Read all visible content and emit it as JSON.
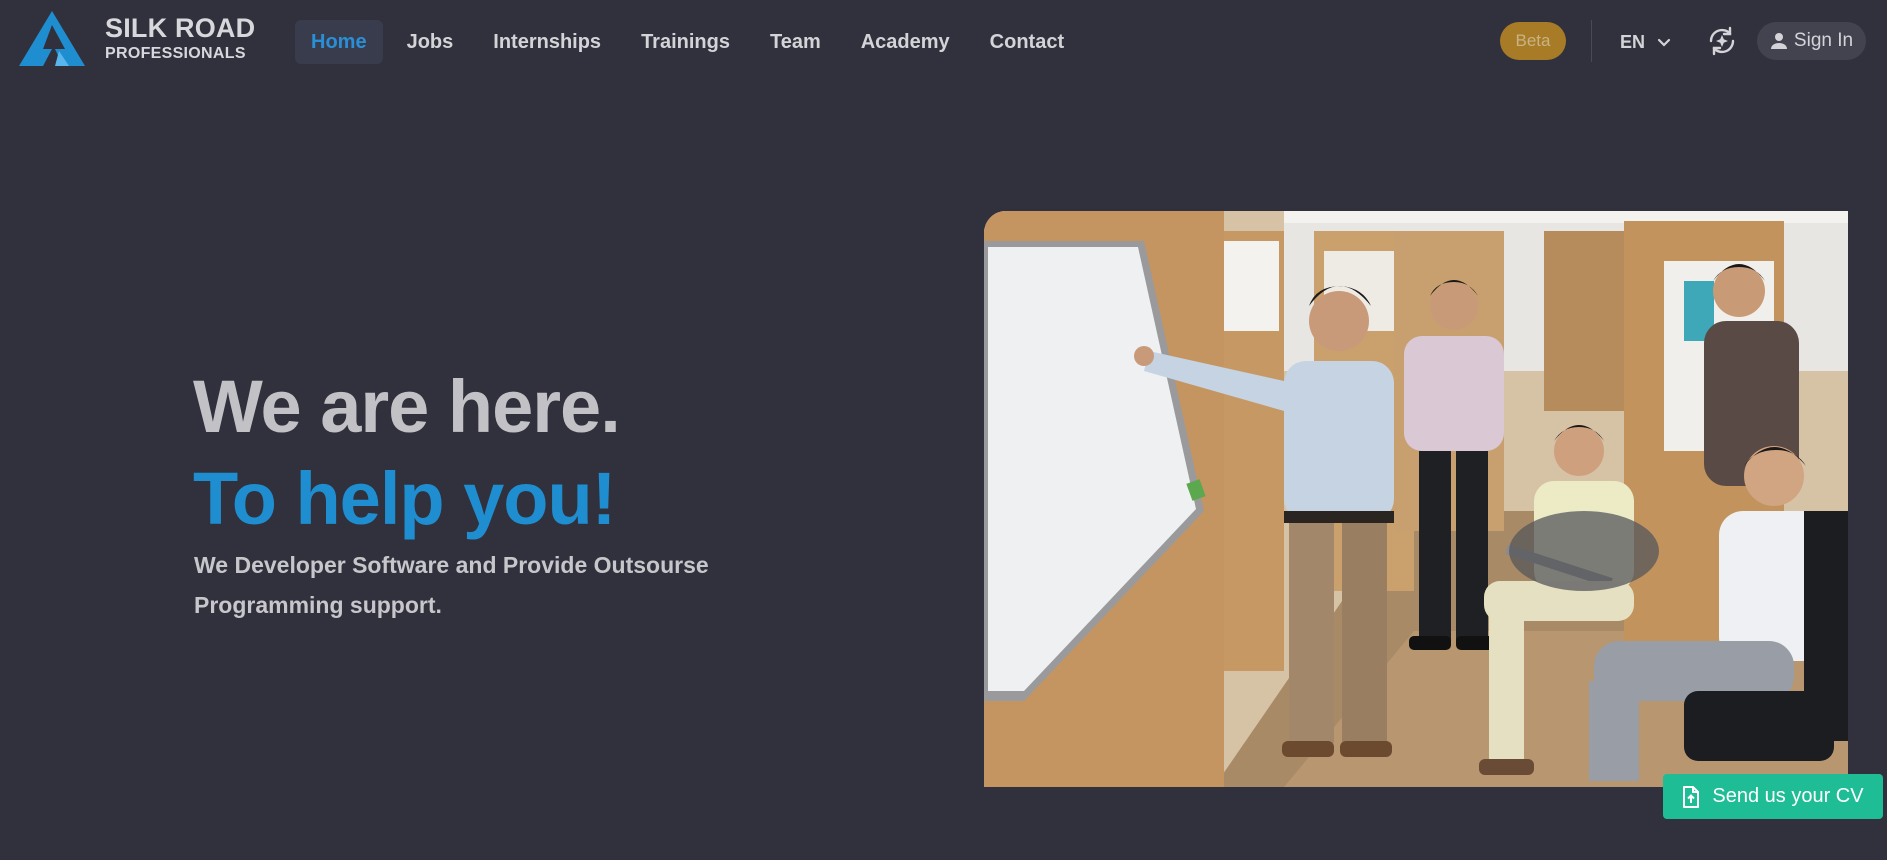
{
  "brand": {
    "name_line1": "SILK ROAD",
    "name_line2": "PROFESSIONALS",
    "logo_icon": "mountain-logo-icon",
    "accent_color": "#1f8ed0"
  },
  "nav": {
    "items": [
      {
        "label": "Home",
        "active": true
      },
      {
        "label": "Jobs",
        "active": false
      },
      {
        "label": "Internships",
        "active": false
      },
      {
        "label": "Trainings",
        "active": false
      },
      {
        "label": "Team",
        "active": false
      },
      {
        "label": "Academy",
        "active": false
      },
      {
        "label": "Contact",
        "active": false
      }
    ]
  },
  "header_actions": {
    "beta_label": "Beta",
    "beta_color": "#a87b27",
    "language": "EN",
    "language_icon": "chevron-down-icon",
    "sync_icon": "sync-icon",
    "signin_label": "Sign In",
    "signin_icon": "user-icon"
  },
  "hero": {
    "title_line1": "We are here.",
    "title_line2": "To help you!",
    "subtitle": "We Developer Software and Provide Outsourse Programming support."
  },
  "cv_button": {
    "label": "Send us your CV",
    "icon": "file-upload-icon",
    "color": "#1fbd96"
  }
}
